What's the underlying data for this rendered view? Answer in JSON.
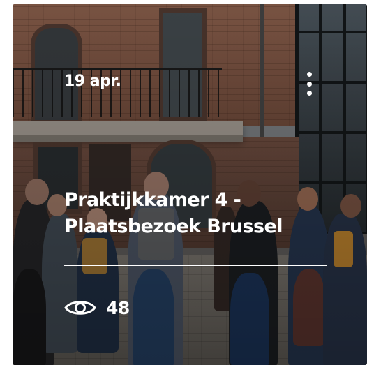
{
  "event_card": {
    "date": "19 apr.",
    "title_line1": "Praktijkkamer 4 -",
    "title_line2": "Plaatsbezoek Brussel",
    "view_count": "48",
    "menu_icon": "more-vertical-icon",
    "views_icon": "eye-icon",
    "overlay_text_color": "#ffffff"
  }
}
